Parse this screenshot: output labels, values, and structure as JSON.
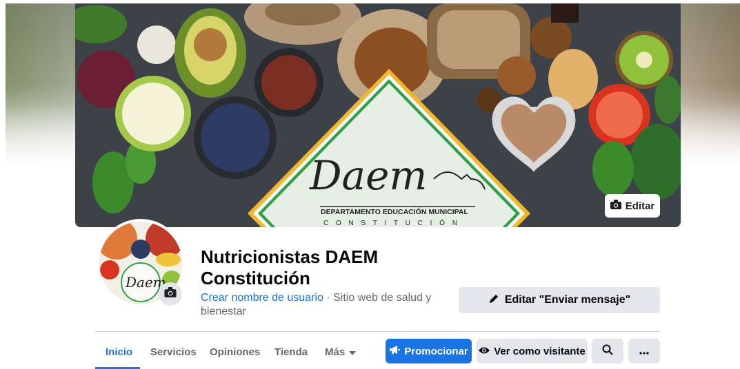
{
  "cover": {
    "logo_script": "Daem",
    "logo_line1": "DEPARTAMENTO EDUCACIÓN MUNICIPAL",
    "logo_line2": "C O N S T I T U C I Ó N",
    "edit_label": "Editar",
    "edit_icon": "camera-icon"
  },
  "profile": {
    "name": "Nutricionistas DAEM Constitución",
    "username_link": "Crear nombre de usuario",
    "separator": " · ",
    "category": "Sitio web de salud y bienestar",
    "avatar_logo": "Daem",
    "camera_icon": "camera-icon"
  },
  "actions": {
    "edit_message_label": "Editar \"Enviar mensaje\"",
    "edit_message_icon": "pencil-icon"
  },
  "tabs": [
    {
      "label": "Inicio",
      "active": true
    },
    {
      "label": "Servicios",
      "active": false
    },
    {
      "label": "Opiniones",
      "active": false
    },
    {
      "label": "Tienda",
      "active": false
    },
    {
      "label": "Más",
      "active": false
    }
  ],
  "buttons": {
    "promote_label": "Promocionar",
    "visitor_label": "Ver como visitante",
    "search_icon": "search-icon",
    "more_icon": "more-icon"
  },
  "colors": {
    "accent": "#1b74e4",
    "button_grey": "#e4e6eb",
    "text_secondary": "#65676b",
    "logo_green": "#2e9e48",
    "logo_yellow": "#f1b82d"
  }
}
